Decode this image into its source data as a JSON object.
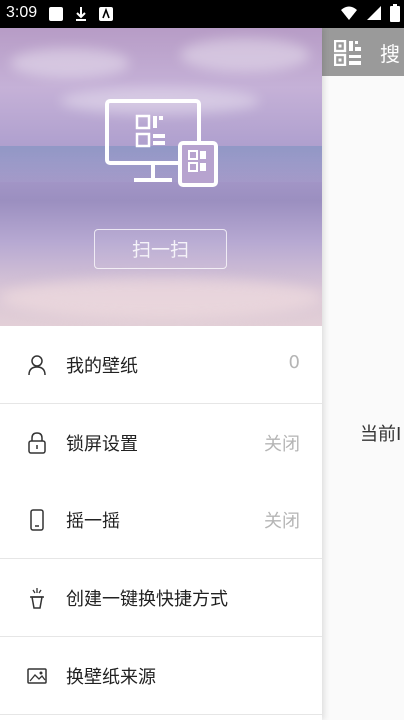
{
  "status_bar": {
    "time": "3:09"
  },
  "drawer": {
    "scan_button": "扫一扫",
    "menu": [
      {
        "label": "我的壁纸",
        "value": "0",
        "icon": "user-icon"
      },
      {
        "label": "锁屏设置",
        "value": "关闭",
        "icon": "lock-icon"
      },
      {
        "label": "摇一摇",
        "value": "关闭",
        "icon": "phone-icon"
      },
      {
        "label": "创建一键换快捷方式",
        "value": "",
        "icon": "magic-hat-icon"
      },
      {
        "label": "换壁纸来源",
        "value": "",
        "icon": "image-icon"
      }
    ]
  },
  "background_page": {
    "search_label": "搜",
    "current_text": "当前I"
  }
}
